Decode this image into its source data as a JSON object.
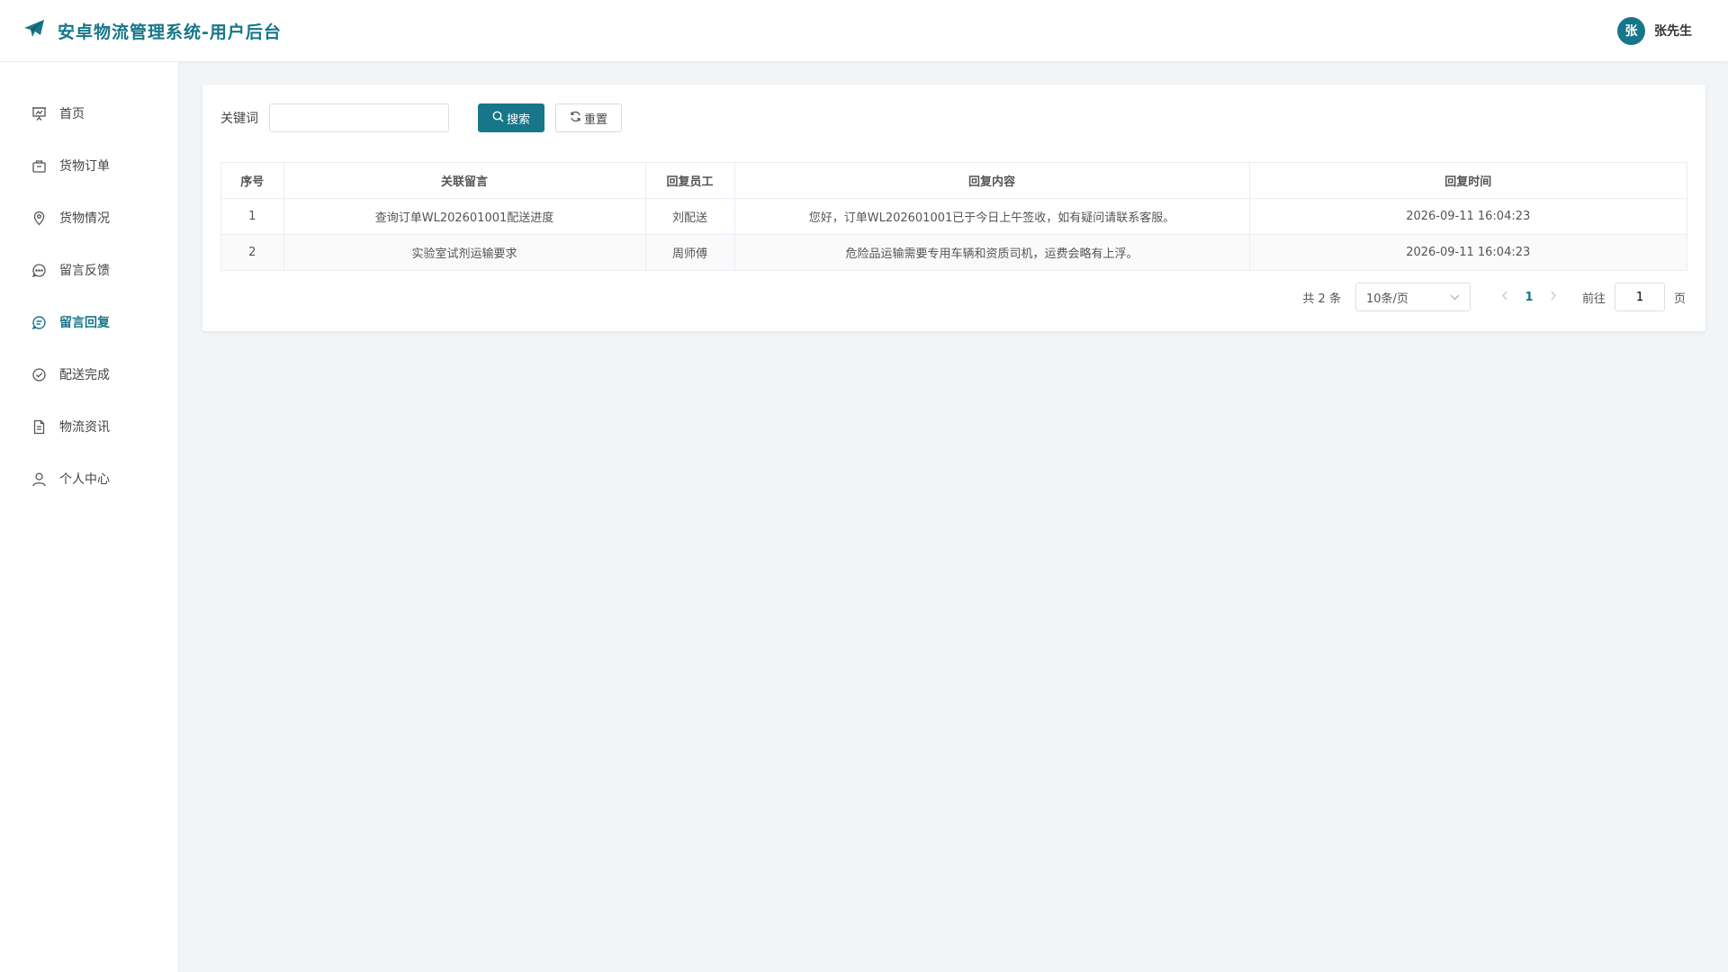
{
  "header": {
    "title": "安卓物流管理系统-用户后台",
    "user_avatar": "张",
    "user_name": "张先生",
    "brand_color": "#177689"
  },
  "sidebar": {
    "items": [
      {
        "label": "首页",
        "icon": "presentation-icon",
        "active": false
      },
      {
        "label": "货物订单",
        "icon": "box-icon",
        "active": false
      },
      {
        "label": "货物情况",
        "icon": "location-pin-icon",
        "active": false
      },
      {
        "label": "留言反馈",
        "icon": "chat-dots-icon",
        "active": false
      },
      {
        "label": "留言回复",
        "icon": "chat-lines-icon",
        "active": true
      },
      {
        "label": "配送完成",
        "icon": "check-circle-icon",
        "active": false
      },
      {
        "label": "物流资讯",
        "icon": "document-icon",
        "active": false
      },
      {
        "label": "个人中心",
        "icon": "user-icon",
        "active": false
      }
    ]
  },
  "search": {
    "label": "关键词",
    "value": "",
    "placeholder": "",
    "search_button": "搜索",
    "reset_button": "重置"
  },
  "table": {
    "columns": [
      "序号",
      "关联留言",
      "回复员工",
      "回复内容",
      "回复时间"
    ],
    "rows": [
      [
        "1",
        "查询订单WL202601001配送进度",
        "刘配送",
        "您好，订单WL202601001已于今日上午签收，如有疑问请联系客服。",
        "2026-09-11 16:04:23"
      ],
      [
        "2",
        "实验室试剂运输要求",
        "周师傅",
        "危险品运输需要专用车辆和资质司机，运费会略有上浮。",
        "2026-09-11 16:04:23"
      ]
    ]
  },
  "pagination": {
    "total": "共 2 条",
    "page_size": "10条/页",
    "current_page": "1",
    "goto_label": "前往",
    "goto_value": "1",
    "page_suffix": "页"
  }
}
